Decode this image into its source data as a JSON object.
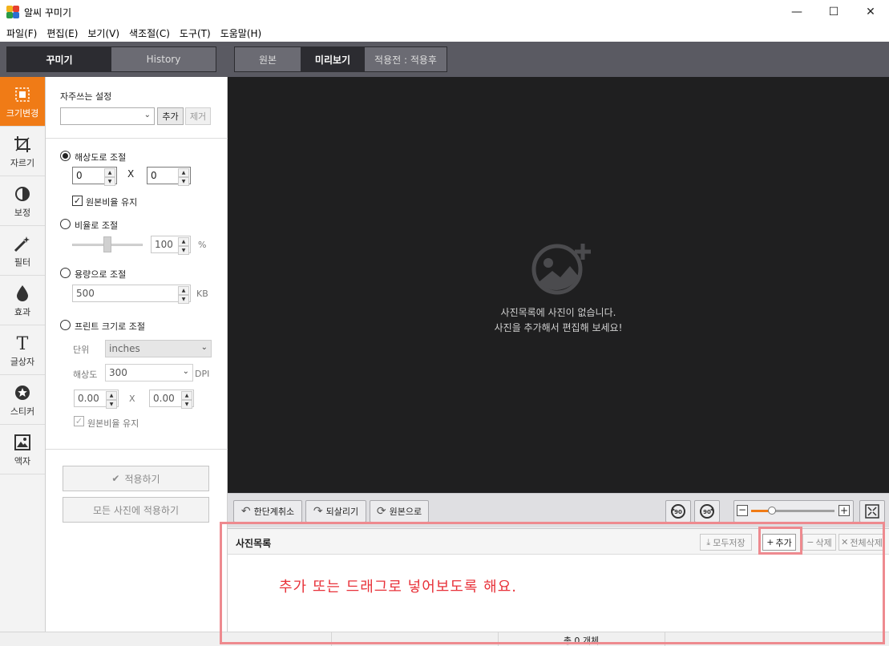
{
  "window": {
    "title": "알씨 꾸미기",
    "minimize": "—",
    "maximize": "☐",
    "close": "✕"
  },
  "menu": [
    "파일(F)",
    "편집(E)",
    "보기(V)",
    "색조절(C)",
    "도구(T)",
    "도움말(H)"
  ],
  "left_tabs": {
    "active": "꾸미기",
    "inactive": "History"
  },
  "view_tabs": {
    "original": "원본",
    "preview": "미리보기",
    "compare": "적용전 : 적용후"
  },
  "tools": [
    {
      "label": "크기변경",
      "icon": "resize-icon",
      "active": true
    },
    {
      "label": "자르기",
      "icon": "crop-icon"
    },
    {
      "label": "보정",
      "icon": "adjust-icon"
    },
    {
      "label": "필터",
      "icon": "filter-wand-icon"
    },
    {
      "label": "효과",
      "icon": "drop-icon"
    },
    {
      "label": "글상자",
      "icon": "text-icon"
    },
    {
      "label": "스티커",
      "icon": "sticker-star-icon"
    },
    {
      "label": "액자",
      "icon": "frame-picture-icon"
    }
  ],
  "settings": {
    "favorites_label": "자주쓰는 설정",
    "favorites_value": "",
    "add": "추가",
    "remove": "제거",
    "resolution": {
      "label": "해상도로 조절",
      "w": "0",
      "x": "X",
      "h": "0",
      "keep_ratio": "원본비율 유지",
      "selected": true
    },
    "ratio": {
      "label": "비율로 조절",
      "value": "100",
      "unit": "%",
      "slider_level": 0.5
    },
    "size": {
      "label": "용량으로 조절",
      "value": "500",
      "unit": "KB"
    },
    "print": {
      "label": "프린트 크기로 조절",
      "unit_label": "단위",
      "unit_value": "inches",
      "res_label": "해상도",
      "res_value": "300",
      "dpi": "DPI",
      "w": "0.00",
      "x": "X",
      "h": "0.00",
      "keep_ratio": "원본비율 유지"
    },
    "apply": "적용하기",
    "apply_all": "모든 사진에 적용하기"
  },
  "preview": {
    "empty_line1": "사진목록에 사진이 없습니다.",
    "empty_line2": "사진을 추가해서 편집해 보세요!"
  },
  "edit_toolbar": {
    "undo": "한단계취소",
    "redo": "되살리기",
    "restore": "원본으로",
    "rotate_left": "90",
    "rotate_right": "90",
    "zoom_level": 0.25
  },
  "photo_list": {
    "title": "사진목록",
    "save_all": "모두저장",
    "add": "추가",
    "delete": "삭제",
    "delete_all": "전체삭제"
  },
  "status": {
    "count": "총 0 개체"
  },
  "annotation": {
    "text": "추가 또는 드래그로 넣어보도록 해요.",
    "color": "#e8323a"
  },
  "colors": {
    "accent": "#f07b16",
    "dark_tab": "#2c2c31",
    "preview_bg": "#1f1f20"
  }
}
